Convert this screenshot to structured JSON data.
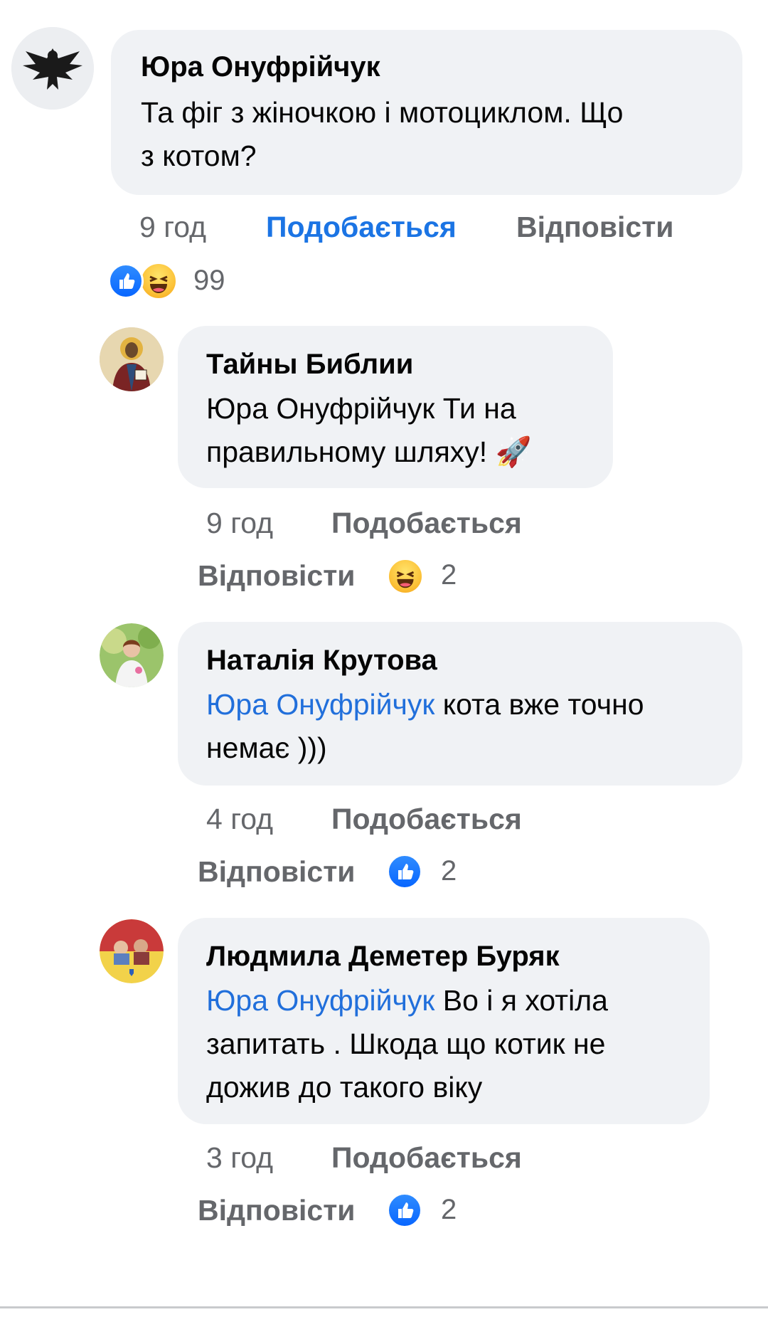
{
  "comments": [
    {
      "author": "Юра Онуфрійчук",
      "text_line1": "Та фіг з жіночкою і мотоциклом. Що",
      "text_line2": "з котом?",
      "time": "9 год",
      "like_label": "Подобається",
      "reply_label": "Відповісти",
      "reaction_count": "99",
      "reaction_icons": [
        "like-icon",
        "haha-icon"
      ],
      "like_color": "#1b74e4"
    },
    {
      "author": "Тайны Библии",
      "text_line1": "Юра Онуфрійчук  Ти на",
      "text_line2": "правильному шляху! 🚀",
      "time": "9 год",
      "like_label": "Подобається",
      "reply_label": "Відповісти",
      "reaction_count": "2",
      "reaction_icons": [
        "haha-icon"
      ]
    },
    {
      "author": "Наталія Крутова",
      "mention": "Юра Онуфрійчук",
      "text_line1_rest": " кота вже точно",
      "text_line2": "немає )))",
      "time": "4 год",
      "like_label": "Подобається",
      "reply_label": "Відповісти",
      "reaction_count": "2",
      "reaction_icons": [
        "like-icon"
      ]
    },
    {
      "author": "Людмила Деметер Буряк",
      "mention": "Юра Онуфрійчук",
      "text_line1_rest": " Во і я хотіла",
      "text_line2": "запитать . Шкода що котик не",
      "text_line3": "дожив до такого віку",
      "time": "3 год",
      "like_label": "Подобається",
      "reply_label": "Відповісти",
      "reaction_count": "2",
      "reaction_icons": [
        "like-icon"
      ]
    }
  ],
  "colors": {
    "bubble": "#f0f2f5",
    "mention": "#216fdb",
    "meta_gray": "#65676b",
    "liked_blue": "#1b74e4"
  }
}
